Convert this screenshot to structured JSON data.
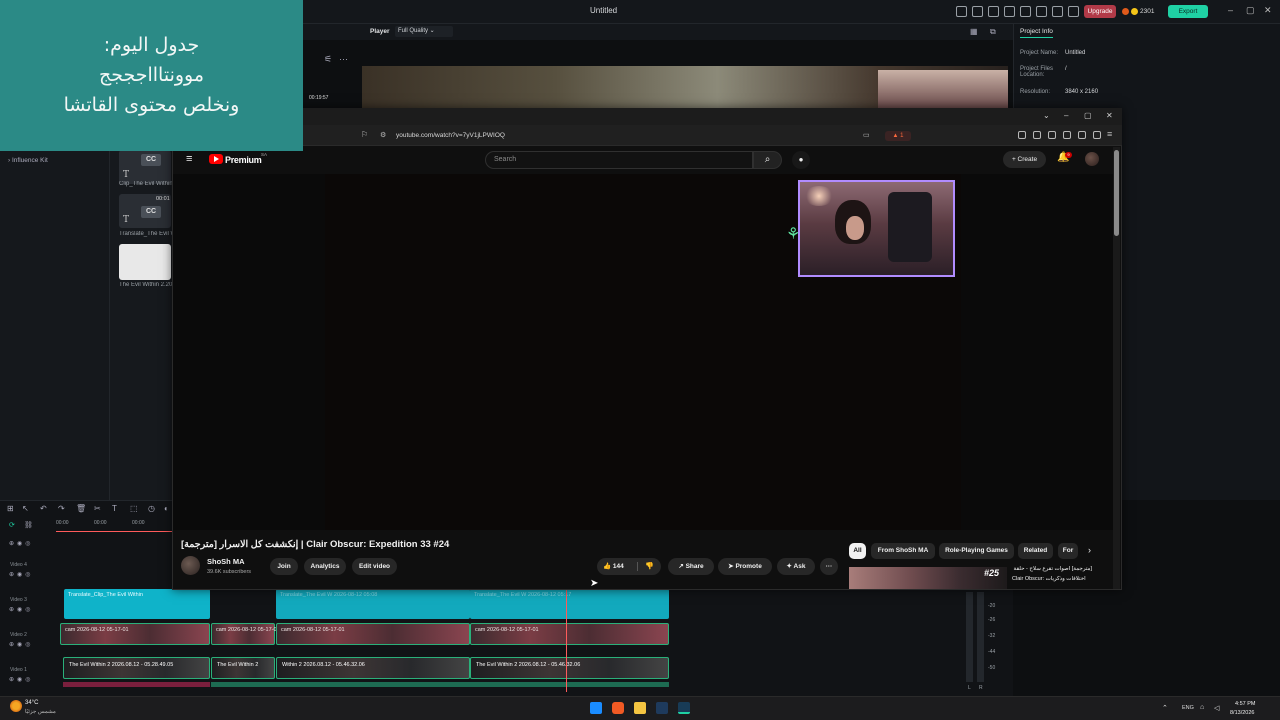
{
  "editor": {
    "window_title": "Untitled",
    "upgrade_label": "Upgrade",
    "credits": "2301",
    "export_label": "Export",
    "player_label": "Player",
    "quality_label": "Full Quality",
    "preview_timecode": "00:19:57",
    "sidebar_item": "Influence Kit",
    "media": [
      {
        "label": "Clip_The Evil Within",
        "duration": ""
      },
      {
        "label": "Translate_The Evil W",
        "duration": "00:01"
      },
      {
        "label": "The Evil Within 2.20",
        "duration": ""
      }
    ],
    "cc_label": "CC",
    "t_label": "T"
  },
  "project_info": {
    "tab_label": "Project Info",
    "name_key": "Project Name:",
    "name_val": "Untitled",
    "files_key": "Project Files Location:",
    "files_val": "/",
    "res_key": "Resolution:",
    "res_val": "3840 x 2160"
  },
  "timeline": {
    "ruler": [
      "00:00",
      "00:00",
      "00:00"
    ],
    "tracks": [
      {
        "label": "Video 4"
      },
      {
        "label": "Video 3"
      },
      {
        "label": "Video 2"
      },
      {
        "label": "Video 1"
      }
    ],
    "cyan_clips": [
      "Translate_Clip_The Evil Within",
      "Translate_The Evil W 2026-08-12 05:08",
      "Translate_The Evil W 2026-08-12 05:17"
    ],
    "cam_clips": [
      "cam 2026-08-12 05-17-01",
      "cam 2026-08-12 05-17-01",
      "cam 2026-08-12 05-17-01",
      "cam 2026-08-12 05-17-01"
    ],
    "game_clips": [
      "The Evil Within 2 2026.08.12 - 05.28.49.05",
      "The Evil Within 2",
      "Within 2 2026.08.12 - 05.46.32.06",
      "The Evil Within 2 2026.08.12 - 05.46.32.06"
    ],
    "meter_labels": [
      "-20",
      "-26",
      "-32",
      "-44",
      "-50",
      "-56",
      "-60",
      "L",
      "R"
    ]
  },
  "browser": {
    "url": "youtube.com/watch?v=7yV1jLPWIOQ",
    "shield_count": "1"
  },
  "youtube": {
    "premium_label": "Premium",
    "country_code": "SA",
    "search_placeholder": "Search",
    "create_label": "Create",
    "notification_count": "9",
    "video_title": "[مترجمة] إنكشفت كل الاسرار | Clair Obscur: Expedition 33 #24",
    "channel_name": "ShoSh MA",
    "subscribers": "39.6K subscribers",
    "join_label": "Join",
    "analytics_label": "Analytics",
    "edit_label": "Edit video",
    "like_count": "144",
    "share_label": "Share",
    "promote_label": "Promote",
    "ask_label": "Ask",
    "more_label": "···",
    "chips": [
      "All",
      "From ShoSh MA",
      "Role-Playing Games",
      "Related",
      "For"
    ],
    "rec_badge": "#25",
    "rec_lines": [
      "[مترجمة] أصوات تقرع سلاح - حلقة",
      "Clair Obscur: اختلافات وذكريات",
      "Expedition 33"
    ]
  },
  "note": {
    "lines": [
      "جدول اليوم:",
      "موونتاااجججج",
      "ونخلص محتوى القاتشا"
    ],
    "background": "#2b8a86"
  },
  "taskbar": {
    "temperature": "34°C",
    "weather_desc": "مشمس جزئيًا",
    "language": "ENG",
    "time": "4:57 PM",
    "date": "8/13/2026"
  }
}
